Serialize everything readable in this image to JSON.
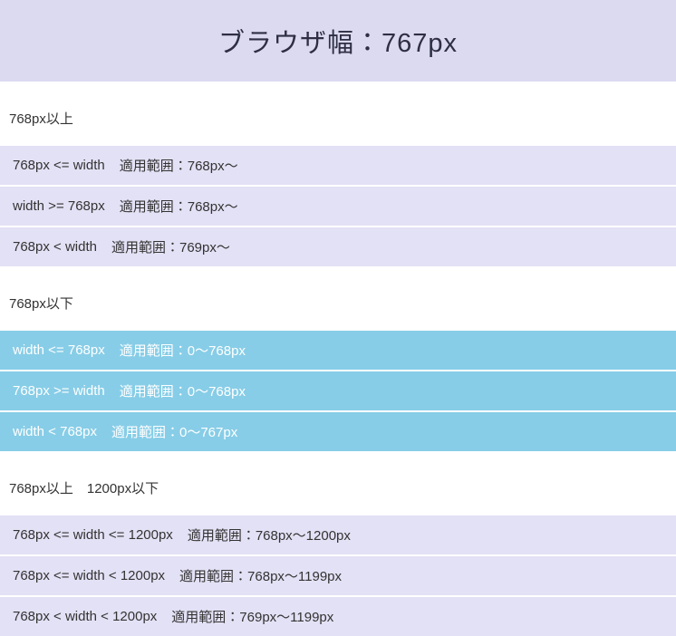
{
  "header": {
    "title": "ブラウザ幅：767px"
  },
  "sections": [
    {
      "heading": "768px以上",
      "state": "inactive",
      "rows": [
        {
          "condition": "768px <= width",
          "range": "適用範囲：768px～"
        },
        {
          "condition": "width >= 768px",
          "range": "適用範囲：768px～"
        },
        {
          "condition": "768px < width",
          "range": "適用範囲：769px～"
        }
      ]
    },
    {
      "heading": "768px以下",
      "state": "active",
      "rows": [
        {
          "condition": "width <= 768px",
          "range": "適用範囲：0～768px"
        },
        {
          "condition": "768px >= width",
          "range": "適用範囲：0～768px"
        },
        {
          "condition": "width < 768px",
          "range": "適用範囲：0～767px"
        }
      ]
    },
    {
      "heading": "768px以上　1200px以下",
      "state": "inactive",
      "rows": [
        {
          "condition": "768px <= width <= 1200px",
          "range": "適用範囲：768px～1200px"
        },
        {
          "condition": "768px <= width < 1200px",
          "range": "適用範囲：768px～1199px"
        },
        {
          "condition": "768px < width < 1200px",
          "range": "適用範囲：769px～1199px"
        }
      ]
    }
  ],
  "colors": {
    "header_bg": "#dcdaf1",
    "row_bg": "#e3e1f5",
    "active_row_bg": "#87cde7",
    "text": "#333333",
    "active_text": "#ffffff"
  }
}
